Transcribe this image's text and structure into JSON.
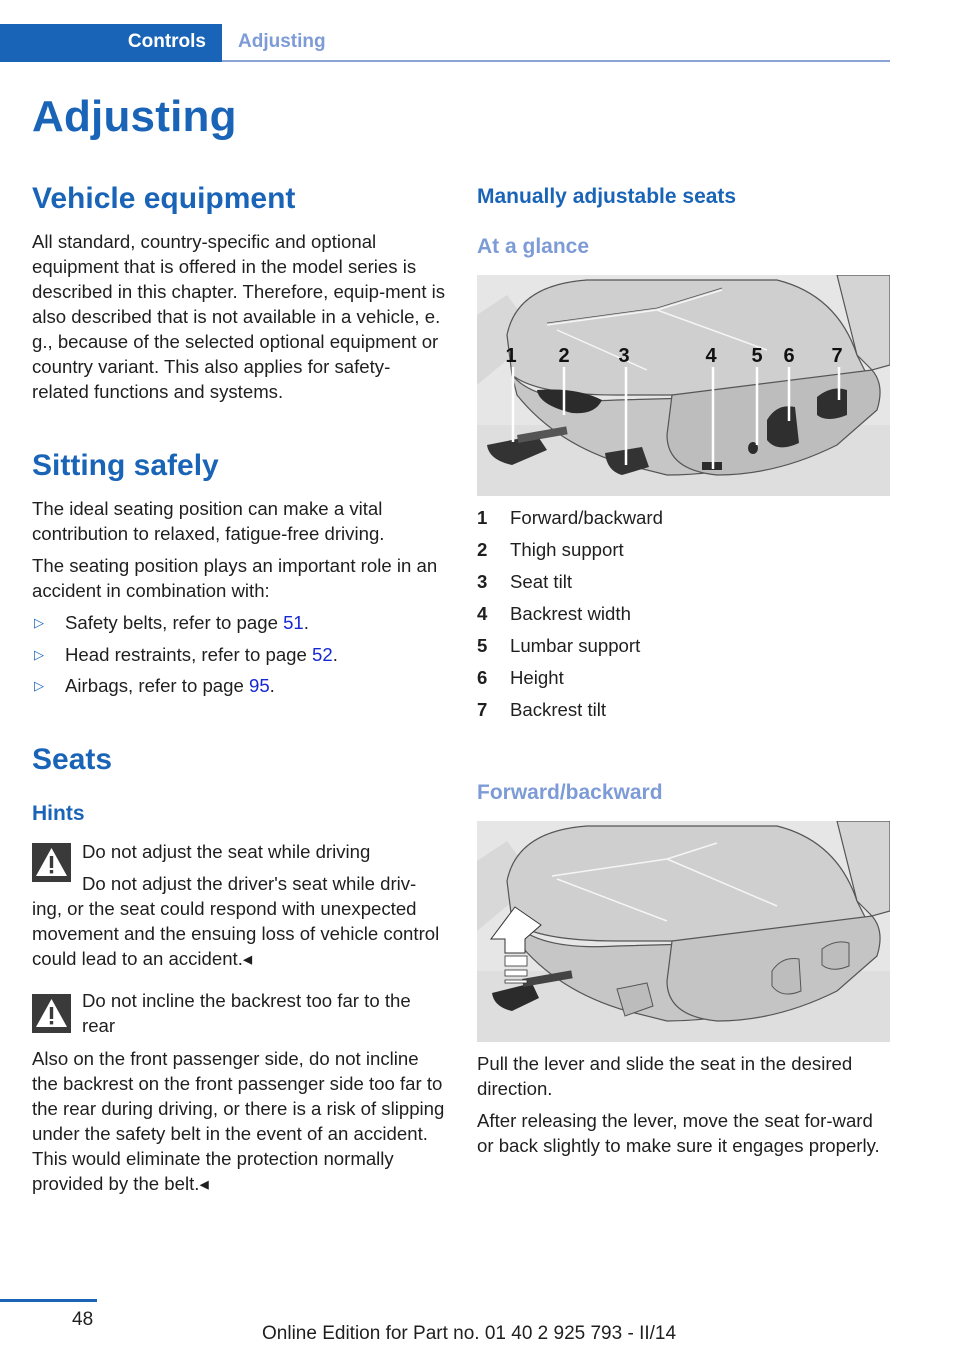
{
  "header": {
    "chapter": "Controls",
    "section": "Adjusting"
  },
  "page_title": "Adjusting",
  "left": {
    "vehicle_equipment": {
      "heading": "Vehicle equipment",
      "body": "All standard, country-specific and optional equipment that is offered in the model series is described in this chapter. Therefore, equip-ment is also described that is not available in a vehicle, e. g., because of the selected optional equipment or country variant. This also applies for safety-related functions and systems."
    },
    "sitting_safely": {
      "heading": "Sitting safely",
      "para1": "The ideal seating position can make a vital contribution to relaxed, fatigue-free driving.",
      "para2": "The seating position plays an important role in an accident in combination with:",
      "bullets": [
        {
          "text": "Safety belts, refer to page ",
          "page": "51",
          "end": "."
        },
        {
          "text": "Head restraints, refer to page ",
          "page": "52",
          "end": "."
        },
        {
          "text": "Airbags, refer to page ",
          "page": "95",
          "end": "."
        }
      ],
      "bullet_icon": "triangle-right-outline"
    },
    "seats": {
      "heading": "Seats",
      "hints_heading": "Hints",
      "warnings": [
        {
          "icon": "warning-triangle",
          "title": "Do not adjust the seat while driving",
          "body_first": "Do not adjust the driver's seat while driv-",
          "body_rest": "ing, or the seat could respond with unexpected movement and the ensuing loss of vehicle control could lead to an accident.◂"
        },
        {
          "icon": "warning-triangle",
          "title": "Do not incline the backrest too far to the rear",
          "body": "Also on the front passenger side, do not incline the backrest on the front passenger side too far to the rear during driving, or there is a risk of slipping under the safety belt in the event of an accident. This would eliminate the protection normally provided by the belt.◂"
        }
      ]
    }
  },
  "right": {
    "heading": "Manually adjustable seats",
    "at_a_glance": {
      "heading": "At a glance",
      "figure_callouts": [
        "1",
        "2",
        "3",
        "4",
        "5",
        "6",
        "7"
      ],
      "legend": [
        {
          "num": "1",
          "label": "Forward/backward"
        },
        {
          "num": "2",
          "label": "Thigh support"
        },
        {
          "num": "3",
          "label": "Seat tilt"
        },
        {
          "num": "4",
          "label": "Backrest width"
        },
        {
          "num": "5",
          "label": "Lumbar support"
        },
        {
          "num": "6",
          "label": "Height"
        },
        {
          "num": "7",
          "label": "Backrest tilt"
        }
      ]
    },
    "forward_backward": {
      "heading": "Forward/backward",
      "para1": "Pull the lever and slide the seat in the desired direction.",
      "para2": "After releasing the lever, move the seat for-ward or back slightly to make sure it engages properly."
    }
  },
  "footer": {
    "page_number": "48",
    "edition": "Online Edition for Part no. 01 40 2 925 793 - II/14"
  },
  "colors": {
    "brand_blue": "#1a64b8",
    "light_blue": "#7d9bd6",
    "link_blue": "#1428d6",
    "warning_icon_bg": "#3a3a3a"
  }
}
